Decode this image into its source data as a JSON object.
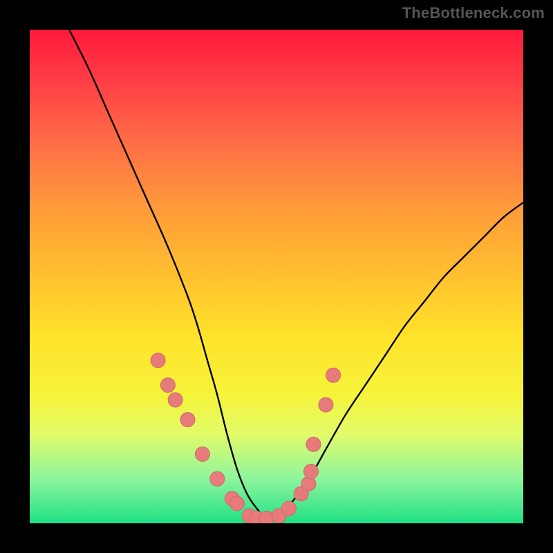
{
  "watermark": "TheBottleneck.com",
  "colors": {
    "frame": "#000000",
    "curve": "#000000",
    "marker_fill": "#e77b7b",
    "marker_stroke": "#cd6868",
    "gradient_stops": [
      "#ff1a3b",
      "#ff3c45",
      "#ff6a47",
      "#ff9a3a",
      "#ffc12e",
      "#ffe22b",
      "#f6f43a",
      "#e2fb6a",
      "#8df59c",
      "#1fe085"
    ]
  },
  "chart_data": {
    "type": "line",
    "title": "",
    "xlabel": "",
    "ylabel": "",
    "xlim": [
      0,
      100
    ],
    "ylim": [
      0,
      100
    ],
    "grid": false,
    "legend": false,
    "series": [
      {
        "name": "bottleneck-curve",
        "x": [
          8,
          12,
          16,
          20,
          24,
          28,
          32,
          34,
          36,
          38,
          40,
          42,
          44,
          46,
          48,
          50,
          52,
          56,
          60,
          64,
          68,
          72,
          76,
          80,
          84,
          88,
          92,
          96,
          100
        ],
        "y": [
          100,
          92,
          83,
          74,
          65,
          56,
          46,
          40,
          33,
          26,
          18,
          11,
          6,
          3,
          1,
          1,
          3,
          8,
          15,
          22,
          28,
          34,
          40,
          45,
          50,
          54,
          58,
          62,
          65
        ]
      }
    ],
    "markers": {
      "name": "sample-markers",
      "x": [
        26,
        28,
        29.5,
        32,
        35,
        38,
        41,
        42,
        44.5,
        46,
        48,
        50.5,
        52.5,
        55,
        56.5,
        57,
        57.5,
        60,
        61.5
      ],
      "y": [
        33,
        28,
        25,
        21,
        14,
        9,
        5,
        4,
        1.5,
        1,
        1,
        1.5,
        3,
        6,
        8,
        10.5,
        16,
        24,
        30
      ]
    }
  }
}
